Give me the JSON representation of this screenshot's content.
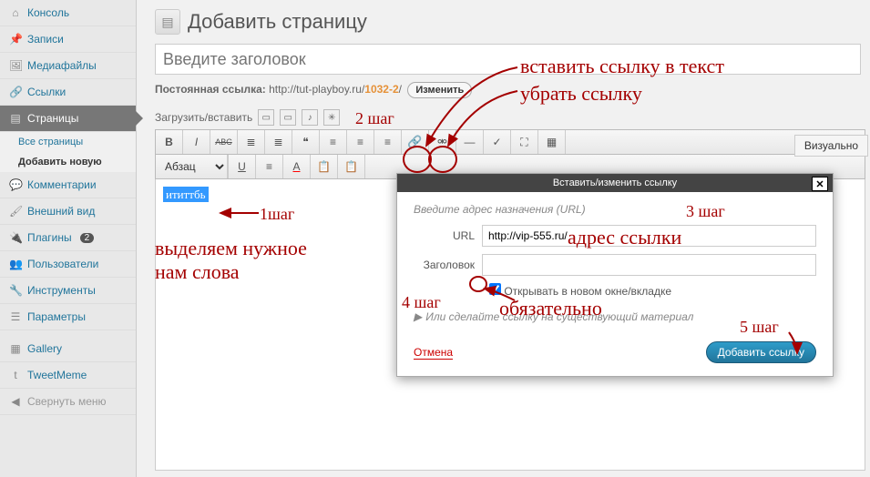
{
  "sidebar": {
    "items": [
      {
        "label": "Консоль",
        "icon": "⌂"
      },
      {
        "label": "Записи",
        "icon": "✎"
      },
      {
        "label": "Медиафайлы",
        "icon": "🖼"
      },
      {
        "label": "Ссылки",
        "icon": "🔗"
      },
      {
        "label": "Страницы",
        "icon": "▤"
      },
      {
        "label": "Комментарии",
        "icon": "💬"
      },
      {
        "label": "Внешний вид",
        "icon": "🎨"
      },
      {
        "label": "Плагины",
        "icon": "🔌",
        "badge": "2"
      },
      {
        "label": "Пользователи",
        "icon": "👥"
      },
      {
        "label": "Инструменты",
        "icon": "🔧"
      },
      {
        "label": "Параметры",
        "icon": "⚙"
      },
      {
        "label": "Gallery",
        "icon": "▦"
      },
      {
        "label": "TweetMeme",
        "icon": "t"
      }
    ],
    "sub": {
      "all": "Все страницы",
      "add": "Добавить новую"
    },
    "collapse": "Свернуть меню"
  },
  "header": {
    "title": "Добавить страницу"
  },
  "title_input": {
    "placeholder": "Введите заголовок"
  },
  "permalink": {
    "label": "Постоянная ссылка:",
    "base": "http://tut-playboy.ru/",
    "slug": "1032-2",
    "slash": "/",
    "edit": "Изменить"
  },
  "upload": {
    "label": "Загрузить/вставить"
  },
  "tabs": {
    "visual": "Визуально"
  },
  "format_select": "Абзац",
  "editor": {
    "selected": "ититтбь"
  },
  "modal": {
    "title": "Вставить/изменить ссылку",
    "hint": "Введите адрес назначения (URL)",
    "url_label": "URL",
    "url_value": "http://vip-555.ru/",
    "title_label": "Заголовок",
    "title_value": "",
    "checkbox": "Открывать в новом окне/вкладке",
    "existing": "Или сделайте ссылку на существующий материал",
    "cancel": "Отмена",
    "submit": "Добавить ссылку"
  },
  "annotations": {
    "step1": "1шаг",
    "step1_text": "выделяем нужное\nнам слова",
    "step2": "2 шаг",
    "insert_link": "вставить ссылку в текст",
    "remove_link": "убрать ссылку",
    "step3": "3 шаг",
    "address": "адрес ссылки",
    "step4": "4 шаг",
    "required": "обязательно",
    "step5": "5 шаг"
  }
}
